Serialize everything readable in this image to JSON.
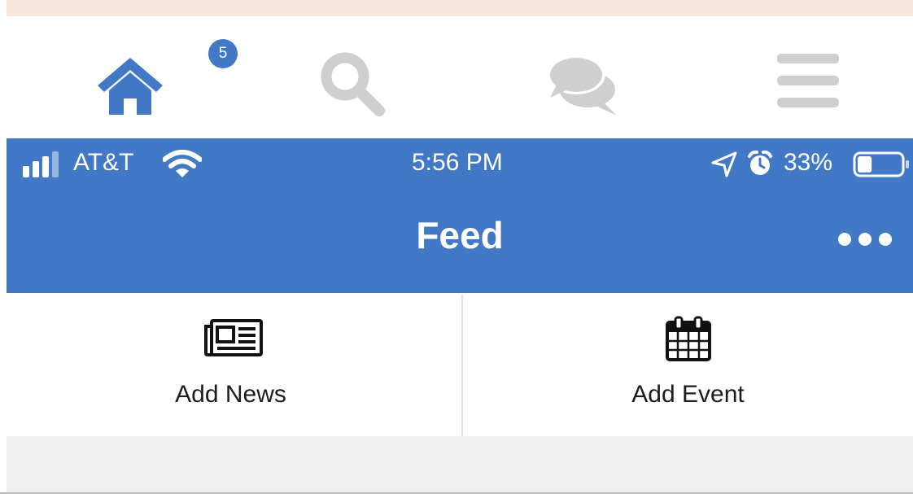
{
  "colors": {
    "brand_blue": "#4279c7",
    "inactive_gray": "#cfcfcf",
    "top_strip": "#f6e7de",
    "empty_area": "#efefef"
  },
  "tabbar": {
    "tabs": [
      {
        "icon": "home-icon",
        "badge": "5",
        "active": true
      },
      {
        "icon": "search-icon",
        "active": false
      },
      {
        "icon": "chat-bubbles-icon",
        "active": false
      },
      {
        "icon": "menu-icon",
        "active": false
      }
    ]
  },
  "status_bar": {
    "carrier": "AT&T",
    "time": "5:56 PM",
    "battery_percent": "33%",
    "battery_level": 0.33,
    "icons": [
      "signal-icon",
      "wifi-icon",
      "location-arrow-icon",
      "alarm-icon",
      "battery-icon"
    ]
  },
  "nav": {
    "title": "Feed",
    "more_icon": "more-horizontal-icon"
  },
  "actions": [
    {
      "label": "Add News",
      "icon": "newspaper-icon"
    },
    {
      "label": "Add Event",
      "icon": "calendar-icon"
    }
  ]
}
